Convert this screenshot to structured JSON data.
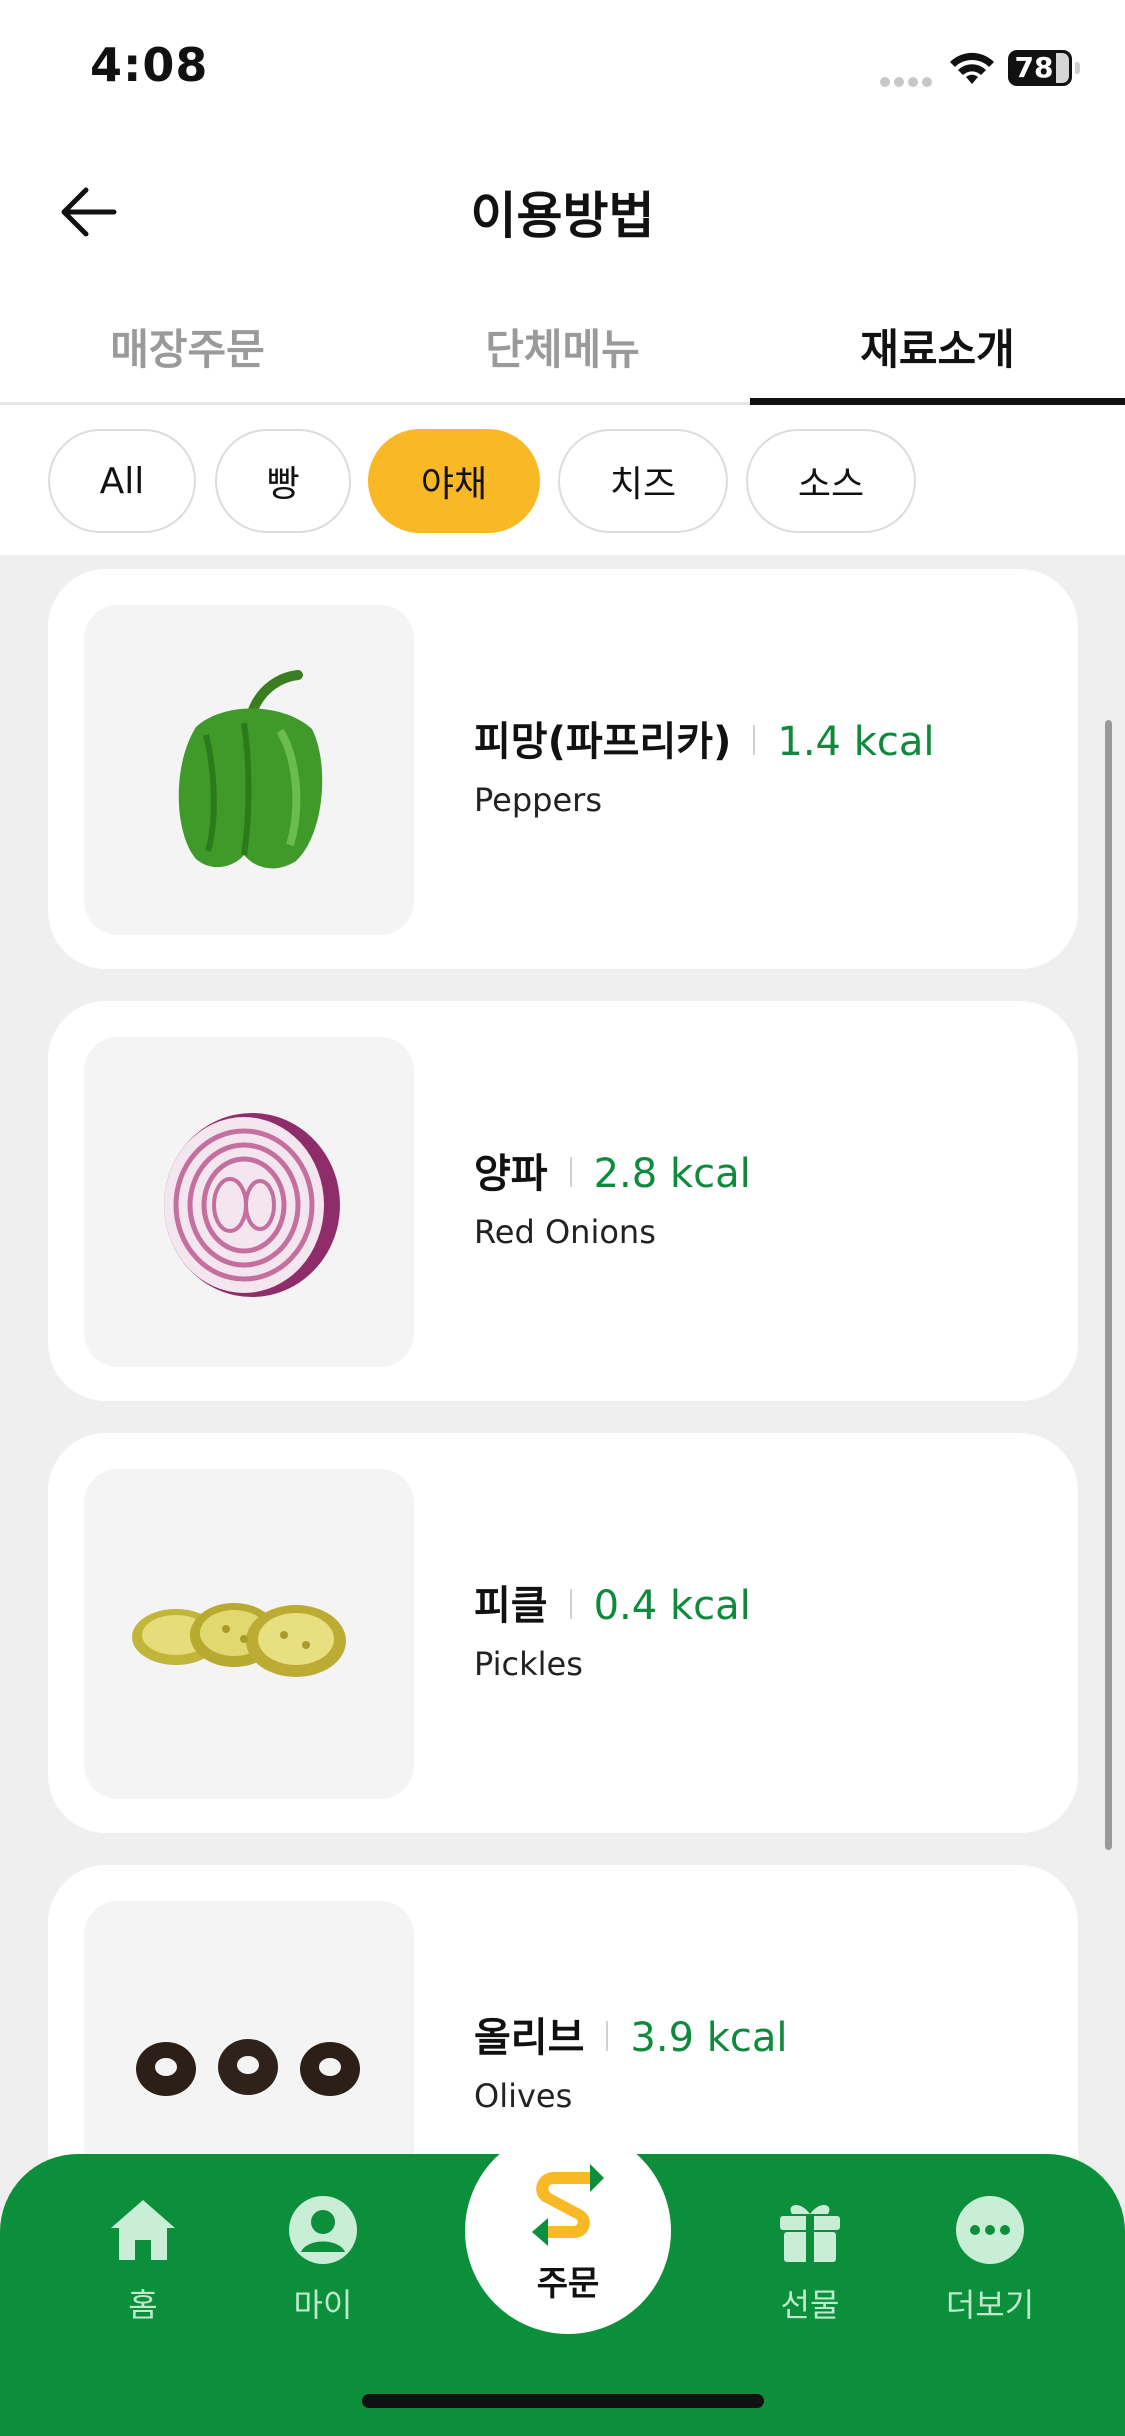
{
  "status_bar": {
    "time": "4:08",
    "battery": "78"
  },
  "header": {
    "title": "이용방법",
    "back_icon": "arrow-left-icon"
  },
  "tabs": [
    {
      "label": "매장주문",
      "active": false
    },
    {
      "label": "단체메뉴",
      "active": false
    },
    {
      "label": "재료소개",
      "active": true
    }
  ],
  "filters": [
    {
      "label": "All",
      "active": false
    },
    {
      "label": "빵",
      "active": false
    },
    {
      "label": "야채",
      "active": true
    },
    {
      "label": "치즈",
      "active": false
    },
    {
      "label": "소스",
      "active": false
    }
  ],
  "items": [
    {
      "name": "피망(파프리카)",
      "kcal": "1.4 kcal",
      "eng": "Peppers",
      "image": "green-pepper-image"
    },
    {
      "name": "양파",
      "kcal": "2.8 kcal",
      "eng": "Red Onions",
      "image": "red-onion-image"
    },
    {
      "name": "피클",
      "kcal": "0.4 kcal",
      "eng": "Pickles",
      "image": "pickles-image"
    },
    {
      "name": "올리브",
      "kcal": "3.9 kcal",
      "eng": "Olives",
      "image": "olives-image"
    }
  ],
  "bottom_nav": {
    "home": "홈",
    "my": "마이",
    "order": "주문",
    "gift": "선물",
    "more": "더보기"
  },
  "colors": {
    "accent_yellow": "#f9b825",
    "brand_green": "#0b8f3b",
    "kcal_green": "#0f8a3d"
  }
}
